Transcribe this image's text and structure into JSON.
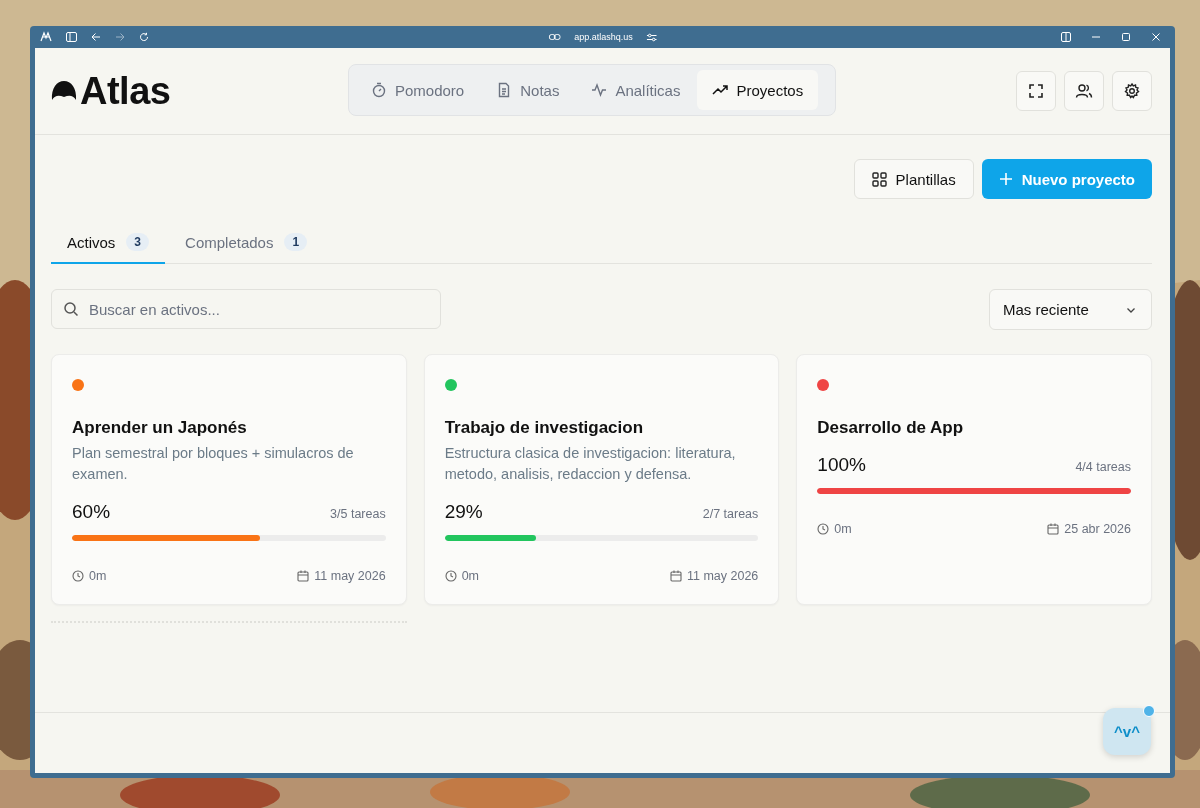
{
  "browser": {
    "url": "app.atlashq.us"
  },
  "header": {
    "logo": "Atlas",
    "nav": [
      {
        "label": "Pomodoro",
        "selected": false
      },
      {
        "label": "Notas",
        "selected": false
      },
      {
        "label": "Analíticas",
        "selected": false
      },
      {
        "label": "Proyectos",
        "selected": true
      }
    ]
  },
  "toolbar": {
    "templates": "Plantillas",
    "new_project": "Nuevo proyecto"
  },
  "tabs": [
    {
      "label": "Activos",
      "count": "3",
      "selected": true
    },
    {
      "label": "Completados",
      "count": "1",
      "selected": false
    }
  ],
  "search": {
    "placeholder": "Buscar en activos..."
  },
  "sort": {
    "value": "Mas reciente"
  },
  "projects": [
    {
      "color": "#f97316",
      "title": "Aprender un Japonés",
      "description": "Plan semestral por bloques + simulacros de examen.",
      "percent": "60%",
      "tasks": "3/5 tareas",
      "level": 0.6,
      "time": "0m",
      "date": "11 may 2026"
    },
    {
      "color": "#22c55e",
      "title": "Trabajo de investigacion",
      "description": "Estructura clasica de investigacion: literatura, metodo, analisis, redaccion y defensa.",
      "percent": "29%",
      "tasks": "2/7 tareas",
      "level": 0.29,
      "time": "0m",
      "date": "11 may 2026"
    },
    {
      "color": "#ef4444",
      "title": "Desarrollo de App",
      "percent": "100%",
      "tasks": "4/4 tareas",
      "level": 1,
      "time": "0m",
      "date": "25 abr 2026"
    }
  ],
  "assistant": {
    "label": "^v^"
  }
}
